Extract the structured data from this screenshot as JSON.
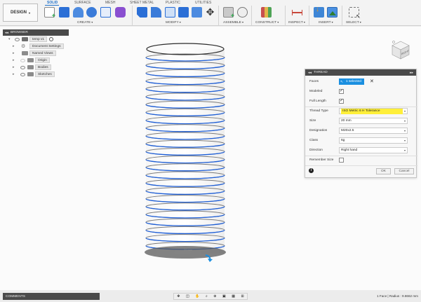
{
  "toolbar": {
    "design_label": "DESIGN",
    "tabs": [
      "SOLID",
      "SURFACE",
      "MESH",
      "SHEET METAL",
      "PLASTIC",
      "UTILITIES"
    ],
    "groups": [
      "CREATE",
      "MODIFY",
      "ASSEMBLE",
      "CONSTRUCT",
      "INSPECT",
      "INSERT",
      "SELECT"
    ]
  },
  "browser": {
    "title": "BROWSER",
    "root": "temp v1",
    "items": [
      "Document Settings",
      "Named Views",
      "Origin",
      "Bodies",
      "Sketches"
    ]
  },
  "viewcube": {
    "face_label": "RIGHT"
  },
  "thread": {
    "title": "THREAD",
    "rows": {
      "faces": {
        "label": "Faces",
        "value": "1 selected"
      },
      "modeled": {
        "label": "Modeled",
        "checked": true
      },
      "full_length": {
        "label": "Full Length",
        "checked": true
      },
      "thread_type": {
        "label": "Thread Type",
        "value": "ISO Metric 6 H Tolerance"
      },
      "size": {
        "label": "Size",
        "value": "20 mm"
      },
      "designation": {
        "label": "Designation",
        "value": "M20x2.5"
      },
      "class": {
        "label": "Class",
        "value": "6g"
      },
      "direction": {
        "label": "Direction",
        "value": "Right hand"
      },
      "remember_size": {
        "label": "Remember Size",
        "checked": false
      }
    },
    "ok_label": "OK",
    "cancel_label": "Cancel"
  },
  "canvas": {
    "selection_label": "20 mm"
  },
  "comments": {
    "label": "COMMENTS"
  },
  "status": {
    "text": "1 Face | Radius : 9.8662 mm"
  },
  "colors": {
    "accent": "#1b8fe0",
    "highlight": "#ffef3a",
    "panel_header": "#4a4a4a",
    "thread_blue": "#1e5fd8"
  }
}
